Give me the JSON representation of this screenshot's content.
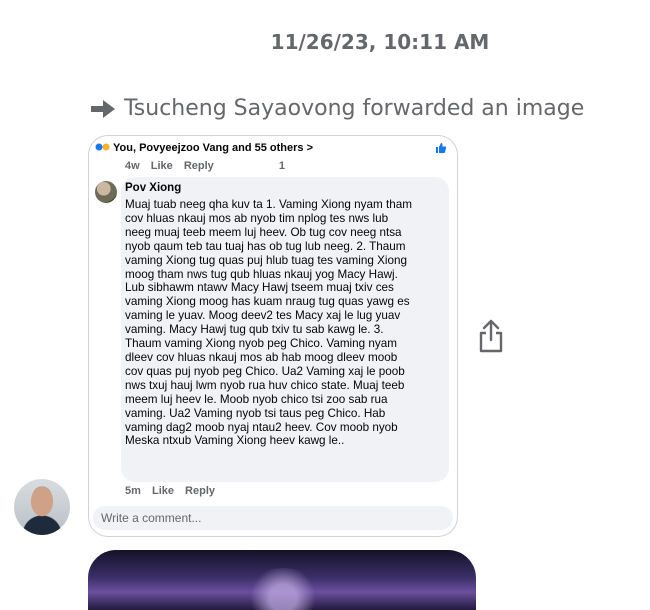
{
  "timestamp": "11/26/23, 10:11 AM",
  "forward": {
    "text": "Tsucheng Sayaovong forwarded an image"
  },
  "image_post": {
    "reactions_text": "You, Povyeejzoo Vang and 55 others >",
    "reactions_meta": {
      "time": "4w",
      "like": "Like",
      "reply": "Reply",
      "count": "1"
    },
    "comment": {
      "author": "Pov Xiong",
      "text": "Muaj tuab neeg qha kuv ta 1. Vaming Xiong nyam tham\ncov hluas nkauj mos ab nyob tim nplog tes nws lub\nneeg muaj teeb meem luj heev.  Ob tug cov neeg ntsa\nnyob qaum teb tau tuaj has ob tug lub neeg.  2.  Thaum\nvaming Xiong tug quas puj hlub tuag tes vaming Xiong\nmoog tham nws tug qub hluas nkauj yog Macy Hawj.\nLub sibhawm ntawv Macy Hawj tseem muaj txiv ces\nvaming Xiong moog has kuam nraug tug quas yawg es\nvaming le yuav.  Moog deev2 tes Macy xaj le lug yuav\nvaming.  Macy Hawj tug qub txiv tu sab kawg le.  3.\nThaum vaming Xiong nyob peg Chico.  Vaming nyam\ndleev cov hluas nkauj mos ab hab moog dleev moob\ncov quas puj nyob peg Chico.  Ua2 Vaming xaj le poob\nnws txuj hauj lwm nyob rua huv chico state.  Muaj teeb\nmeem luj heev le.  Moob nyob chico tsi zoo sab rua\nvaming.  Ua2 Vaming nyob tsi taus peg Chico.  Hab\nvaming dag2 moob nyaj ntau2 heev.  Cov moob nyob\nMeska ntxub Vaming Xiong heev kawg le..",
      "time": "5m",
      "like": "Like",
      "reply": "Reply"
    },
    "write_comment_placeholder": "Write a comment..."
  },
  "colors": {
    "text_secondary": "#65676b",
    "text_primary": "#050505",
    "bubble_bg": "#f0f2f5",
    "fb_blue": "#1877f2"
  },
  "icons": {
    "forward": "arrow-right-icon",
    "share": "share-icon",
    "like": "thumbs-up-icon"
  }
}
